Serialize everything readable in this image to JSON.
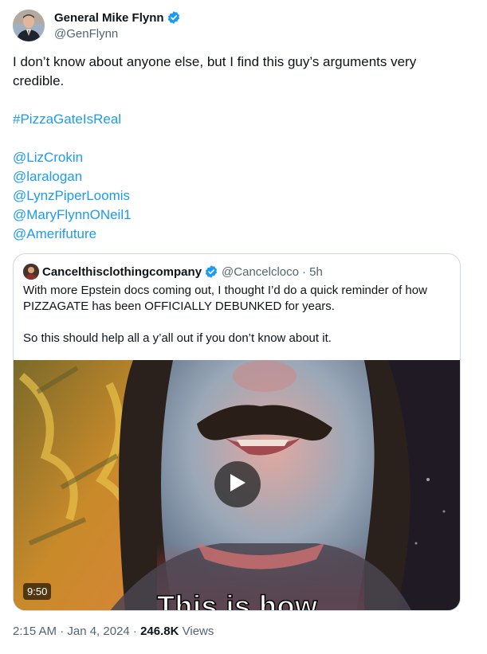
{
  "author": {
    "name": "General Mike Flynn",
    "handle": "@GenFlynn"
  },
  "tweet": {
    "text_line": "I don’t know about anyone else, but I find this guy’s arguments very credible.",
    "hashtag": "#PizzaGateIsReal",
    "mentions": [
      "@LizCrokin",
      "@laralogan",
      "@LynzPiperLoomis",
      "@MaryFlynnONeil1",
      "@Amerifuture"
    ]
  },
  "quote": {
    "name": "Cancelthisclothingcompany",
    "handle": "@Cancelcloco",
    "time": "· 5h",
    "text1": "With more Epstein docs coming out, I thought I’d do a quick reminder of how PIZZAGATE has been OFFICIALLY DEBUNKED for years.",
    "text2": "So this should help all a y’all out if you don’t know about it.",
    "video_duration": "9:50",
    "video_caption": "This is how"
  },
  "meta": {
    "time": "2:15 AM · Jan 4, 2024 · ",
    "views_count": "246.8K",
    "views_label": " Views"
  },
  "colors": {
    "link": "#1d9bf0",
    "verified": "#1d9bf0",
    "secondary_text": "#536471"
  }
}
